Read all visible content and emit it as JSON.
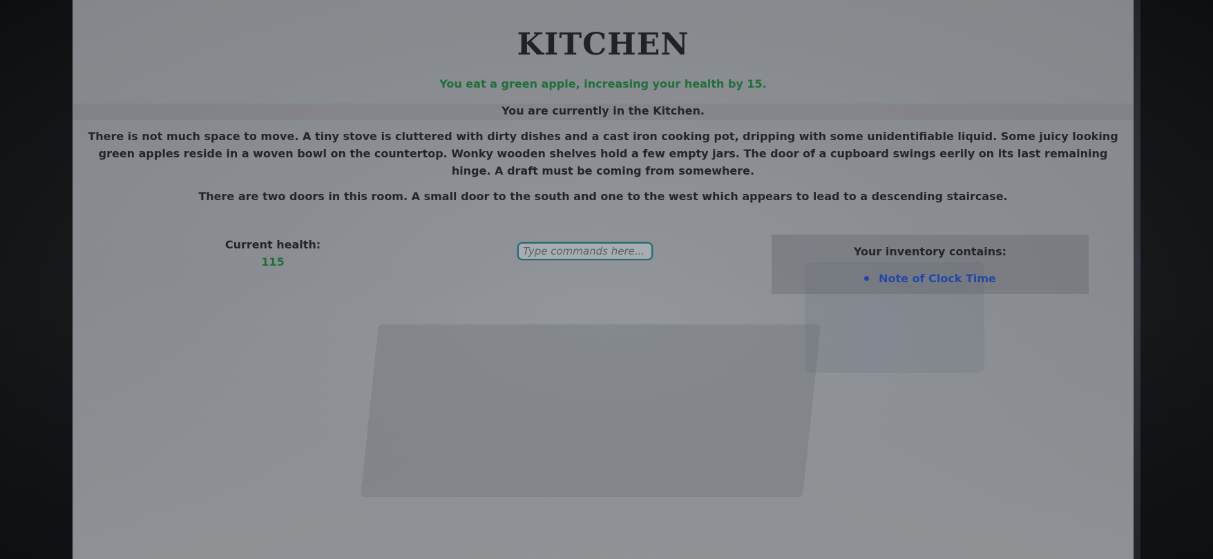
{
  "room": {
    "title": "KITCHEN",
    "event_message": "You eat a green apple, increasing your health by 15.",
    "location_message": "You are currently in the Kitchen.",
    "description": "There is not much space to move. A tiny stove is cluttered with dirty dishes and a cast iron cooking pot, dripping with some unidentifiable liquid. Some juicy looking green apples reside in a woven bowl on the countertop. Wonky wooden shelves hold a few empty jars. The door of a cupboard swings eerily on its last remaining hinge. A draft must be coming from somewhere.",
    "exits": "There are two doors in this room. A small door to the south and one to the west which appears to lead to a descending staircase."
  },
  "health": {
    "label": "Current health:",
    "value": "115"
  },
  "command_input": {
    "value": "",
    "placeholder": "Type commands here..."
  },
  "inventory": {
    "title": "Your inventory contains:",
    "items": [
      {
        "label": "Note of Clock Time"
      }
    ]
  },
  "colors": {
    "positive": "#1e6f3a",
    "item_link": "#2446a8",
    "text": "#222629",
    "input_border": "#236b74"
  }
}
